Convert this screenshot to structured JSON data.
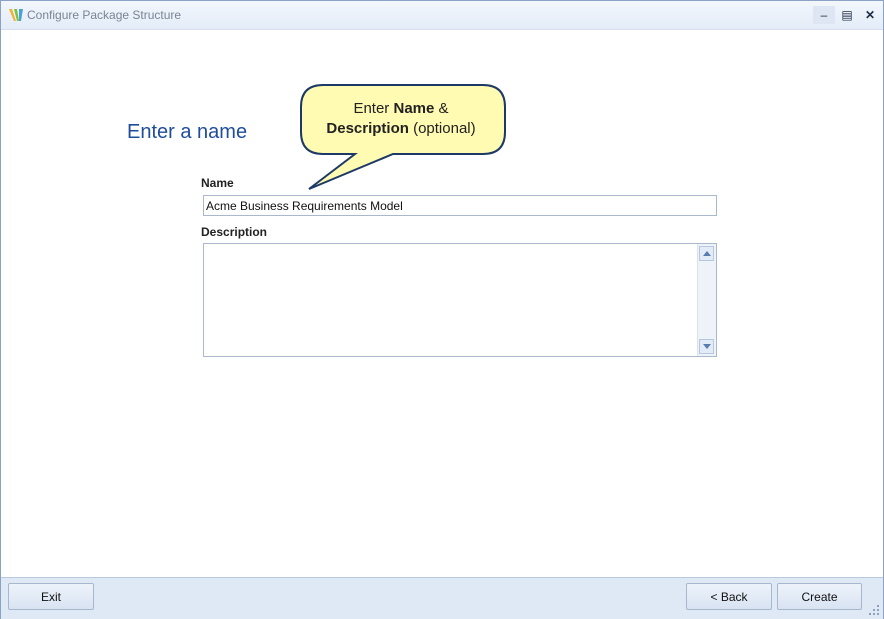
{
  "window": {
    "title": "Configure Package Structure"
  },
  "page": {
    "heading": "Enter a name"
  },
  "callout": {
    "prefix": "Enter ",
    "name_bold": "Name",
    "amp": "  &",
    "description_bold": "Description",
    "suffix": " (optional)"
  },
  "form": {
    "name_label": "Name",
    "name_value": "Acme Business Requirements Model",
    "description_label": "Description",
    "description_value": ""
  },
  "footer": {
    "exit_label": "Exit",
    "back_label": "< Back",
    "create_label": "Create"
  },
  "colors": {
    "heading": "#1f4d9b",
    "callout_fill": "#fffbb2",
    "callout_stroke": "#1d3a66"
  },
  "icons": [
    "app-icon",
    "minimize-icon",
    "maximize-icon",
    "close-icon",
    "scroll-up-icon",
    "scroll-down-icon",
    "resize-grip-icon"
  ]
}
